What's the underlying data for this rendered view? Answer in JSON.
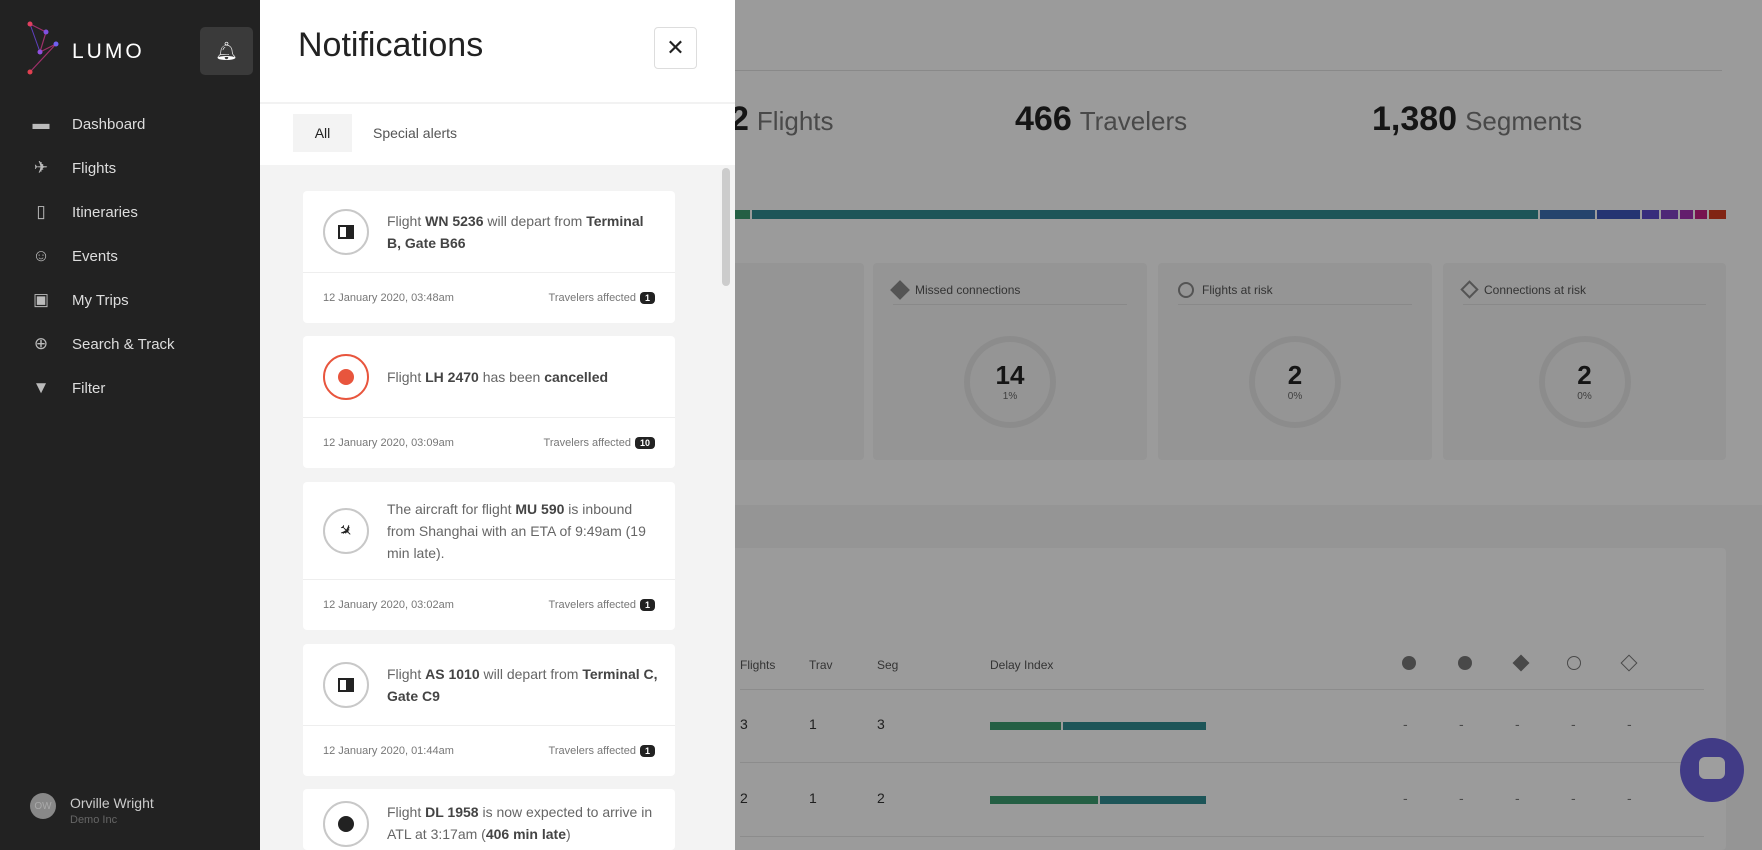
{
  "app": {
    "brand": "LUMO"
  },
  "sidebar": {
    "items": [
      {
        "label": "Dashboard",
        "icon": "dashboard-icon"
      },
      {
        "label": "Flights",
        "icon": "plane-icon"
      },
      {
        "label": "Itineraries",
        "icon": "itinerary-icon"
      },
      {
        "label": "Events",
        "icon": "people-icon"
      },
      {
        "label": "My Trips",
        "icon": "badge-icon"
      },
      {
        "label": "Search & Track",
        "icon": "plus-circle-icon"
      },
      {
        "label": "Filter",
        "icon": "filter-icon"
      }
    ],
    "user": {
      "initials": "OW",
      "name": "Orville Wright",
      "company": "Demo Inc"
    }
  },
  "notifications": {
    "title": "Notifications",
    "tabs": [
      "All",
      "Special alerts"
    ],
    "active_tab": "All",
    "items": [
      {
        "icon": "gate-icon",
        "parts": [
          [
            "Flight ",
            ""
          ],
          [
            "WN 5236",
            "b"
          ],
          [
            " will depart from ",
            ""
          ],
          [
            "Terminal B, Gate B66",
            "b"
          ]
        ],
        "time": "12 January 2020, 03:48am",
        "affected_label": "Travelers affected",
        "affected": "1"
      },
      {
        "icon": "cancelled-icon",
        "parts": [
          [
            "Flight ",
            ""
          ],
          [
            "LH 2470",
            "b"
          ],
          [
            " has been ",
            ""
          ],
          [
            "cancelled",
            "b"
          ]
        ],
        "time": "12 January 2020, 03:09am",
        "affected_label": "Travelers affected",
        "affected": "10"
      },
      {
        "icon": "arrival-icon",
        "parts": [
          [
            "The aircraft for flight ",
            ""
          ],
          [
            "MU 590",
            "b"
          ],
          [
            " is inbound from Shanghai with an ETA of 9:49am (19 min late).",
            ""
          ]
        ],
        "time": "12 January 2020, 03:02am",
        "affected_label": "Travelers affected",
        "affected": "1"
      },
      {
        "icon": "gate-icon",
        "parts": [
          [
            "Flight ",
            ""
          ],
          [
            "AS 1010",
            "b"
          ],
          [
            " will depart from ",
            ""
          ],
          [
            "Terminal C, Gate C9",
            "b"
          ]
        ],
        "time": "12 January 2020, 01:44am",
        "affected_label": "Travelers affected",
        "affected": "1"
      },
      {
        "icon": "clock-icon",
        "parts": [
          [
            "Flight ",
            ""
          ],
          [
            "DL 1958",
            "b"
          ],
          [
            " is now expected to arrive in ATL at 3:17am (",
            ""
          ],
          [
            "406 min late",
            "b"
          ],
          [
            ")",
            ""
          ]
        ],
        "time": "",
        "affected_label": "",
        "affected": ""
      }
    ]
  },
  "main": {
    "stats": [
      {
        "value": "2",
        "label": "Flights"
      },
      {
        "value": "466",
        "label": "Travelers"
      },
      {
        "value": "1,380",
        "label": "Segments"
      }
    ],
    "kpis": [
      {
        "label": "Missed connections",
        "value": "14",
        "pct": "1%"
      },
      {
        "label": "Flights at risk",
        "value": "2",
        "pct": "0%"
      },
      {
        "label": "Connections at risk",
        "value": "2",
        "pct": "0%"
      }
    ],
    "table": {
      "headers": [
        "Flights",
        "Trav",
        "Seg",
        "Delay Index"
      ],
      "rows": [
        {
          "flights": "3",
          "trav": "1",
          "seg": "3",
          "delay": [
            0.33,
            0.67
          ],
          "cols": [
            "-",
            "-",
            "-",
            "-",
            "-"
          ]
        },
        {
          "flights": "2",
          "trav": "1",
          "seg": "2",
          "delay": [
            0.5,
            0.5
          ],
          "cols": [
            "-",
            "-",
            "-",
            "-",
            "-"
          ]
        }
      ]
    },
    "colors": {
      "green": "#3a9a6e",
      "teal": "#2f8a8f",
      "accent": "#6a5fd8"
    }
  }
}
